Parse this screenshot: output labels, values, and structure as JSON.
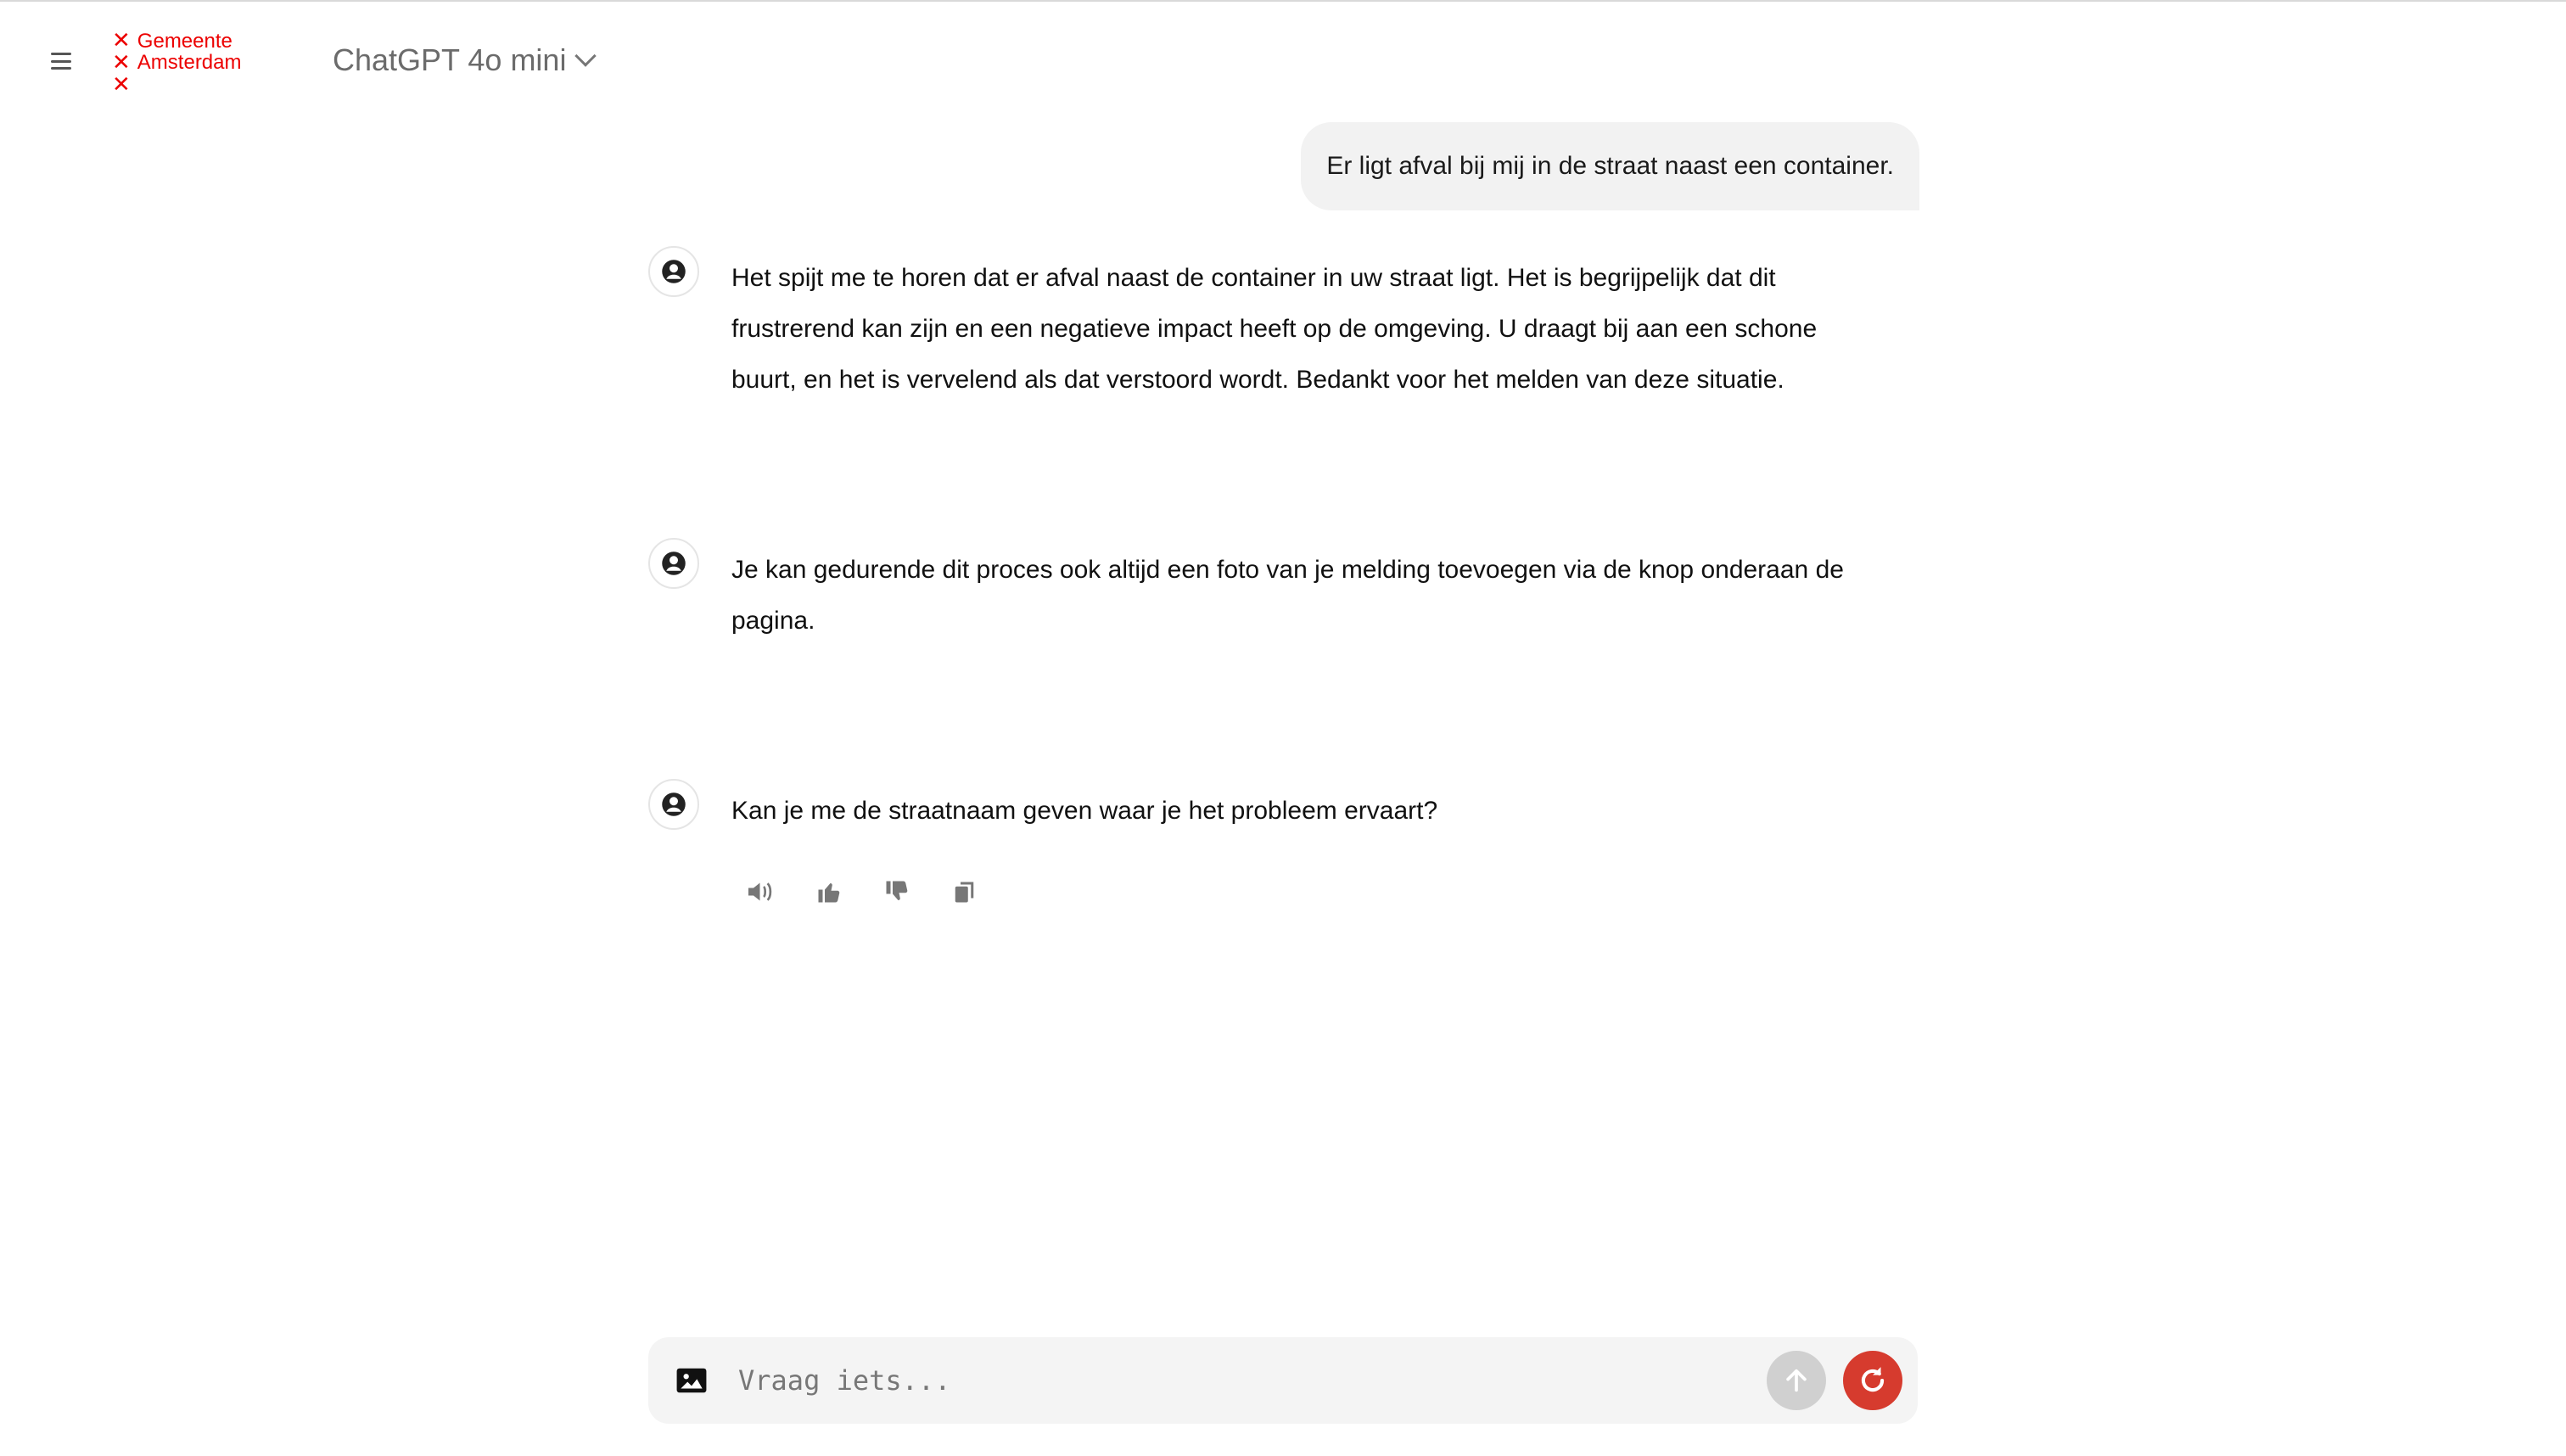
{
  "header": {
    "menu_icon": "hamburger-icon",
    "logo": {
      "line1": "Gemeente",
      "line2": "Amsterdam",
      "mark": "×××",
      "color": "#ec0000"
    },
    "model_label": "ChatGPT 4o mini"
  },
  "conversation": {
    "user_message": "Er ligt afval bij mij in de straat naast een container.",
    "assistant_messages": [
      {
        "text": "Het spijt me te horen dat er afval naast de container in uw straat ligt. Het is begrijpelijk dat dit frustrerend kan zijn en een negatieve impact heeft op de omgeving. U draagt bij aan een schone buurt, en het is vervelend als dat verstoord wordt. Bedankt voor het melden van deze situatie."
      },
      {
        "text": "Je kan gedurende dit proces ook altijd een foto van je melding toevoegen via de knop onderaan de pagina."
      },
      {
        "text": "Kan je me de straatnaam geven waar je het probleem ervaart?"
      }
    ],
    "action_icons": [
      "speaker-icon",
      "thumbs-up-icon",
      "thumbs-down-icon",
      "copy-icon"
    ]
  },
  "composer": {
    "placeholder": "Vraag iets...",
    "value": "",
    "accent": "#d63b2e"
  }
}
